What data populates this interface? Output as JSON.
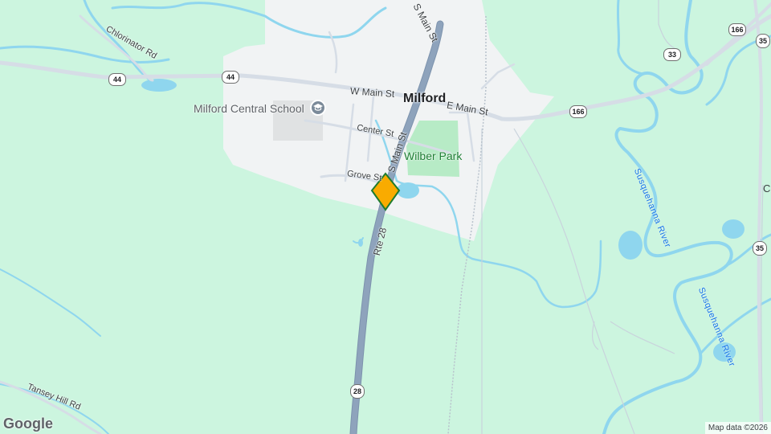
{
  "map": {
    "town_name": "Milford",
    "streets": {
      "w_main": "W Main St",
      "e_main": "E Main St",
      "s_main": "S Main St",
      "center": "Center St",
      "grove": "Grove St",
      "chlorinator": "Chlorinator Rd",
      "tansey": "Tansey Hill Rd",
      "rte28": "Rte 28"
    },
    "pois": {
      "school": "Milford Central School",
      "park": "Wilber Park"
    },
    "rivers": {
      "label_a": "Susquehanna River",
      "label_b": "Susquehanna River"
    },
    "shields": {
      "r44_left": "44",
      "r44_right": "44",
      "r166_mid": "166",
      "r166_top": "166",
      "r35_top": "35",
      "r35_right": "35",
      "r33": "33",
      "r28": "28"
    },
    "edge_letter_right": "C",
    "google_logo": "Google",
    "attribution": "Map data ©2026",
    "colors": {
      "land": "#ccf5df",
      "town": "#f1f3f4",
      "water": "#8fd6ee",
      "highway": "#8ea3bc",
      "road": "#d6dde6",
      "marker": "#f9ab00",
      "marker_outline": "#1e7b2e",
      "park": "#b7ebc6"
    }
  }
}
